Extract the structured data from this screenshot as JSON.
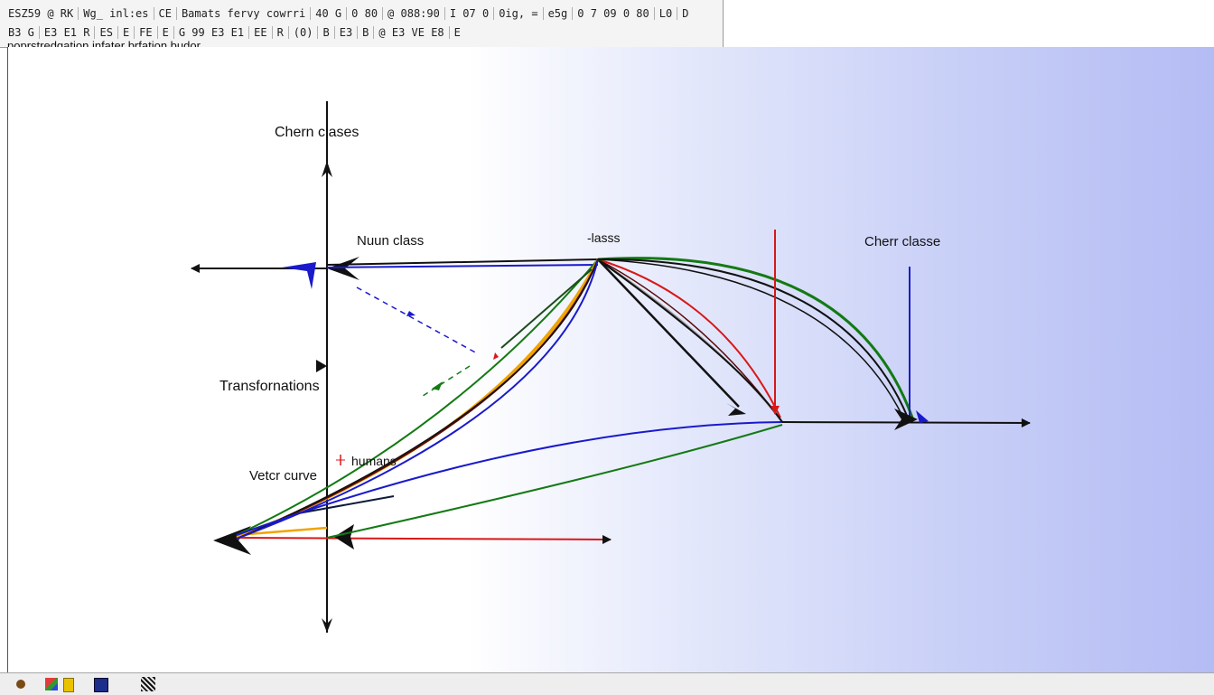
{
  "toolbar": {
    "row1": [
      "ESZ59 @ RK",
      "Wg_ inl:es",
      "CE",
      "Bamats fervy cowrri",
      "40 G",
      "0 80",
      "@ 088:90",
      "I 07 0",
      "0ig, =",
      "e5g",
      "0 7 09 0 80",
      "L0",
      "D"
    ],
    "row2": [
      "B3 G",
      "E3 E1 R",
      "ES",
      "E",
      "FE",
      "E",
      "G 99 E3 E1",
      "EE",
      "R",
      "(0)",
      "B",
      "E3",
      "B",
      "@ E3 VE E8",
      "E"
    ]
  },
  "document_label": "poprstredgation infater brfation budor",
  "labels": {
    "chern_classes": "Chern clases",
    "nuun_class": "Nuun class",
    "lasss": "-lasss",
    "cherr_classe": "Cherr classe",
    "transformations": "Transfornations",
    "vetcr_curve": "Vetcr curve",
    "humans": "humans"
  },
  "colors": {
    "black": "#111111",
    "blue": "#1a1acc",
    "green": "#137a13",
    "red": "#d81818",
    "orange": "#f0a400",
    "dark_red": "#5a0a0a",
    "gray": "#9a9a9a",
    "navy": "#0d1a3a",
    "canvas_gradient_end": "#b4bcf4"
  },
  "taskbar": {
    "icons": [
      "orb-icon",
      "paint-icon",
      "folder-icon",
      "monitor-icon",
      "grid-icon"
    ]
  }
}
